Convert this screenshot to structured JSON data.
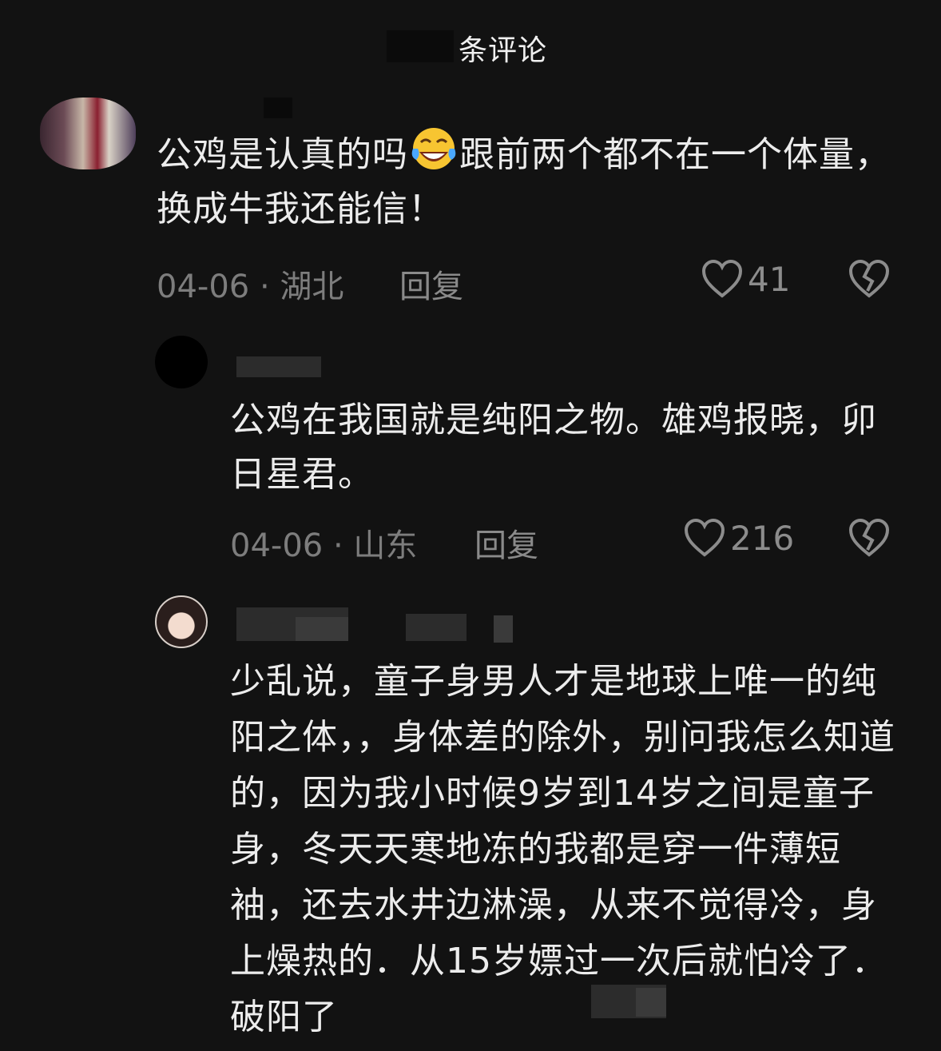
{
  "header": {
    "title": "条评论"
  },
  "comments": [
    {
      "text_before_emoji": "公鸡是认真的吗",
      "emoji": "laughing-crying-emoji",
      "text_after_emoji": "跟前两个都不在一个体量，换成牛我还能信！",
      "date_location": "04-06 · 湖北",
      "reply_label": "回复",
      "likes": "41"
    },
    {
      "text": "公鸡在我国就是纯阳之物。雄鸡报晓，卯日星君。",
      "date_location": "04-06 · 山东",
      "reply_label": "回复",
      "likes": "216"
    },
    {
      "text": "少乱说，童子身男人才是地球上唯一的纯阳之体，，身体差的除外，别问我怎么知道的，因为我小时候9岁到14岁之间是童子身，冬天天寒地冻的我都是穿一件薄短袖，还去水井边淋澡，从来不觉得冷，身上燥热的．从15岁嫖过一次后就怕冷了．破阳了"
    }
  ],
  "colors": {
    "background": "#121212",
    "text": "#ececec",
    "meta": "#7d7d7d"
  }
}
